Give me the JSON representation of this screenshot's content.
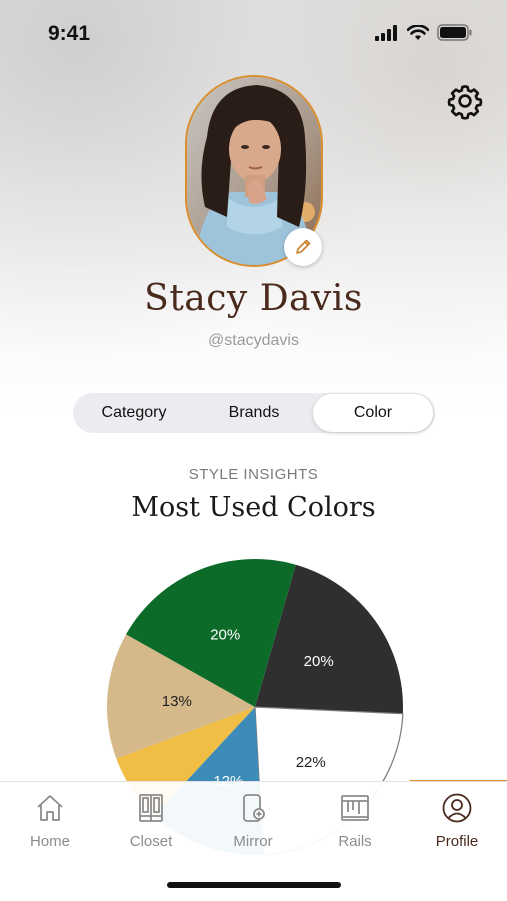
{
  "status_bar": {
    "time": "9:41"
  },
  "profile": {
    "name": "Stacy Davis",
    "handle": "@stacydavis"
  },
  "segments": [
    {
      "label": "Category",
      "active": false
    },
    {
      "label": "Brands",
      "active": false
    },
    {
      "label": "Color",
      "active": true
    }
  ],
  "insights": {
    "label": "STYLE INSIGHTS",
    "title": "Most Used Colors"
  },
  "chart_data": {
    "type": "pie",
    "title": "Most Used Colors",
    "slices": [
      {
        "label": "20%",
        "value": 20,
        "color": "#2f2f2f"
      },
      {
        "label": "22%",
        "value": 22,
        "color": "#ffffff"
      },
      {
        "label": "12%",
        "value": 12,
        "color": "#3d8bb8"
      },
      {
        "label": "",
        "value": 7,
        "color": "#f0bd45"
      },
      {
        "label": "13%",
        "value": 13,
        "color": "#d5b98a"
      },
      {
        "label": "20%",
        "value": 20,
        "color": "#0d6b2a"
      }
    ]
  },
  "tabs": [
    {
      "label": "Home",
      "icon": "home-icon"
    },
    {
      "label": "Closet",
      "icon": "closet-icon"
    },
    {
      "label": "Mirror",
      "icon": "mirror-icon"
    },
    {
      "label": "Rails",
      "icon": "rails-icon"
    },
    {
      "label": "Profile",
      "icon": "profile-icon",
      "active": true
    }
  ],
  "colors": {
    "accent": "#d98f2e",
    "brand_text": "#4a2a1d"
  }
}
